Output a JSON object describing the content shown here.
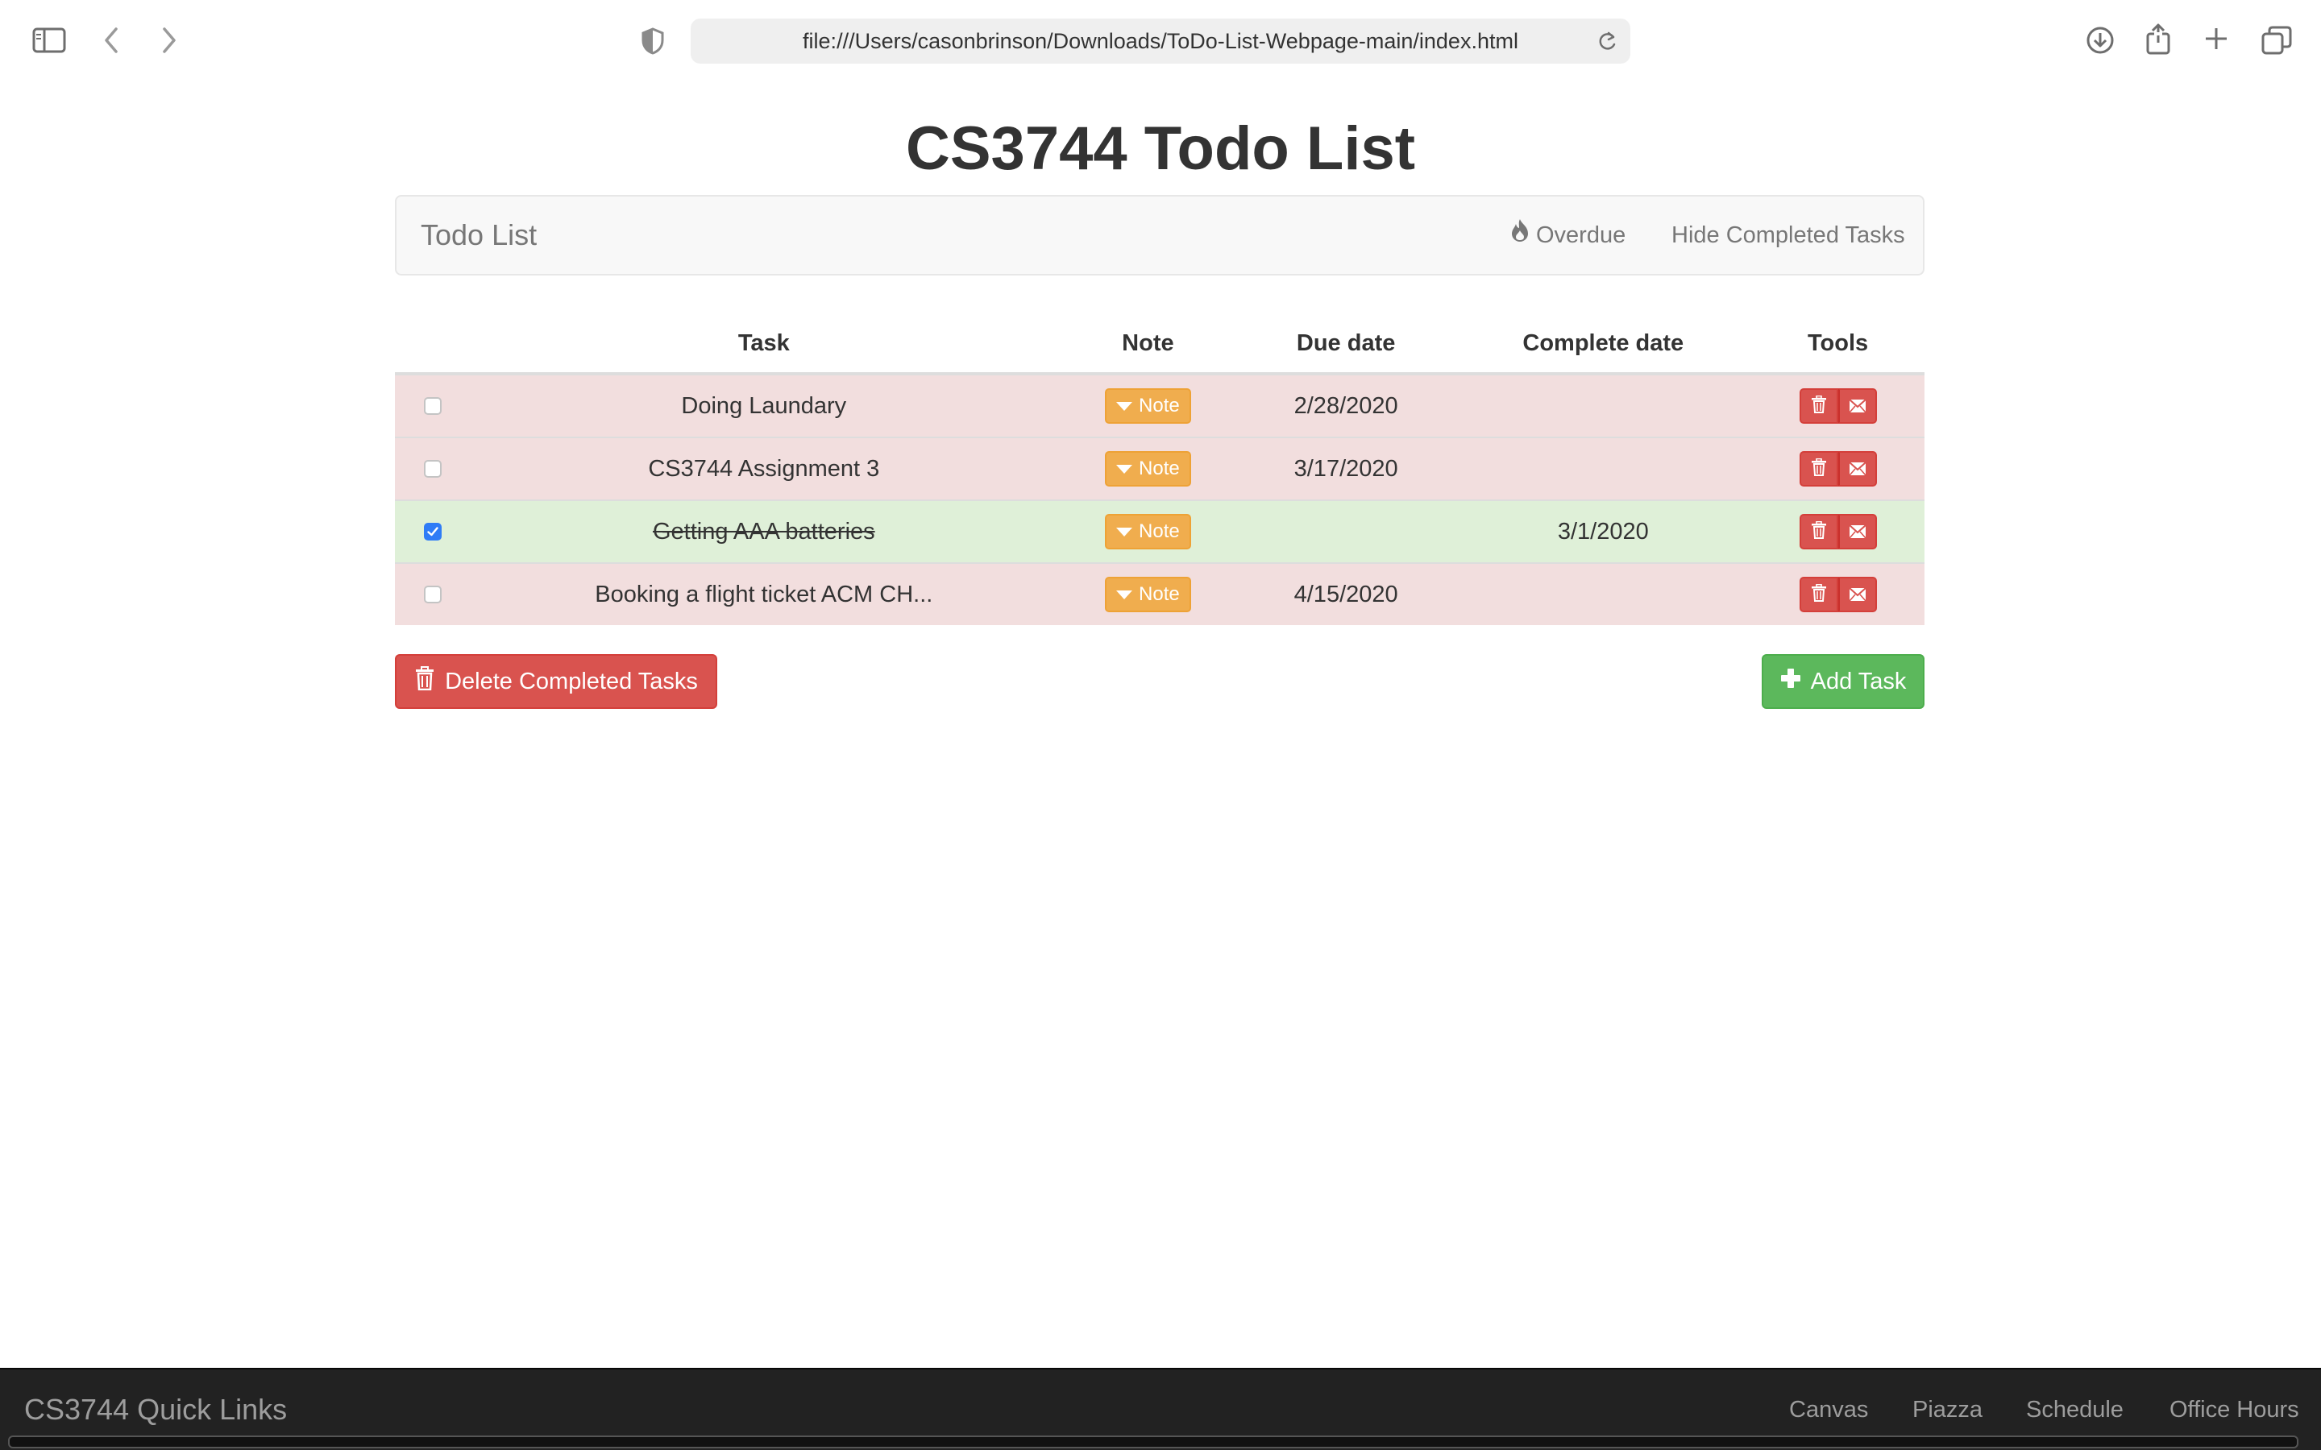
{
  "browser": {
    "url": "file:///Users/casonbrinson/Downloads/ToDo-List-Webpage-main/index.html",
    "icons": [
      "sidebar-icon",
      "back-icon",
      "forward-icon",
      "shield-icon",
      "reload-icon",
      "download-icon",
      "share-icon",
      "new-tab-icon",
      "tabs-overview-icon"
    ]
  },
  "page": {
    "title": "CS3744 Todo List"
  },
  "navbar": {
    "brand": "Todo List",
    "overdue_label": "Overdue",
    "hide_completed_label": "Hide Completed Tasks"
  },
  "table": {
    "headers": {
      "task": "Task",
      "note": "Note",
      "due": "Due date",
      "complete": "Complete date",
      "tools": "Tools"
    },
    "rows": [
      {
        "checked": false,
        "task": "Doing Laundary",
        "note_label": "Note",
        "due": "2/28/2020",
        "complete": "",
        "status": "overdue"
      },
      {
        "checked": false,
        "task": "CS3744 Assignment 3",
        "note_label": "Note",
        "due": "3/17/2020",
        "complete": "",
        "status": "overdue"
      },
      {
        "checked": true,
        "task": "Getting AAA batteries",
        "note_label": "Note",
        "due": "",
        "complete": "3/1/2020",
        "status": "completed"
      },
      {
        "checked": false,
        "task": "Booking a flight ticket ACM CH...",
        "note_label": "Note",
        "due": "4/15/2020",
        "complete": "",
        "status": "overdue"
      }
    ]
  },
  "actions": {
    "delete_completed_label": "Delete Completed Tasks",
    "add_task_label": "Add Task"
  },
  "footer": {
    "brand": "CS3744 Quick Links",
    "links": [
      "Canvas",
      "Piazza",
      "Schedule",
      "Office Hours"
    ]
  },
  "colors": {
    "overdue_row": "#f2dede",
    "completed_row": "#dff0d8",
    "danger": "#d9534f",
    "warning": "#f0ad4e",
    "success": "#5cb85c",
    "footer_bg": "#222222"
  }
}
